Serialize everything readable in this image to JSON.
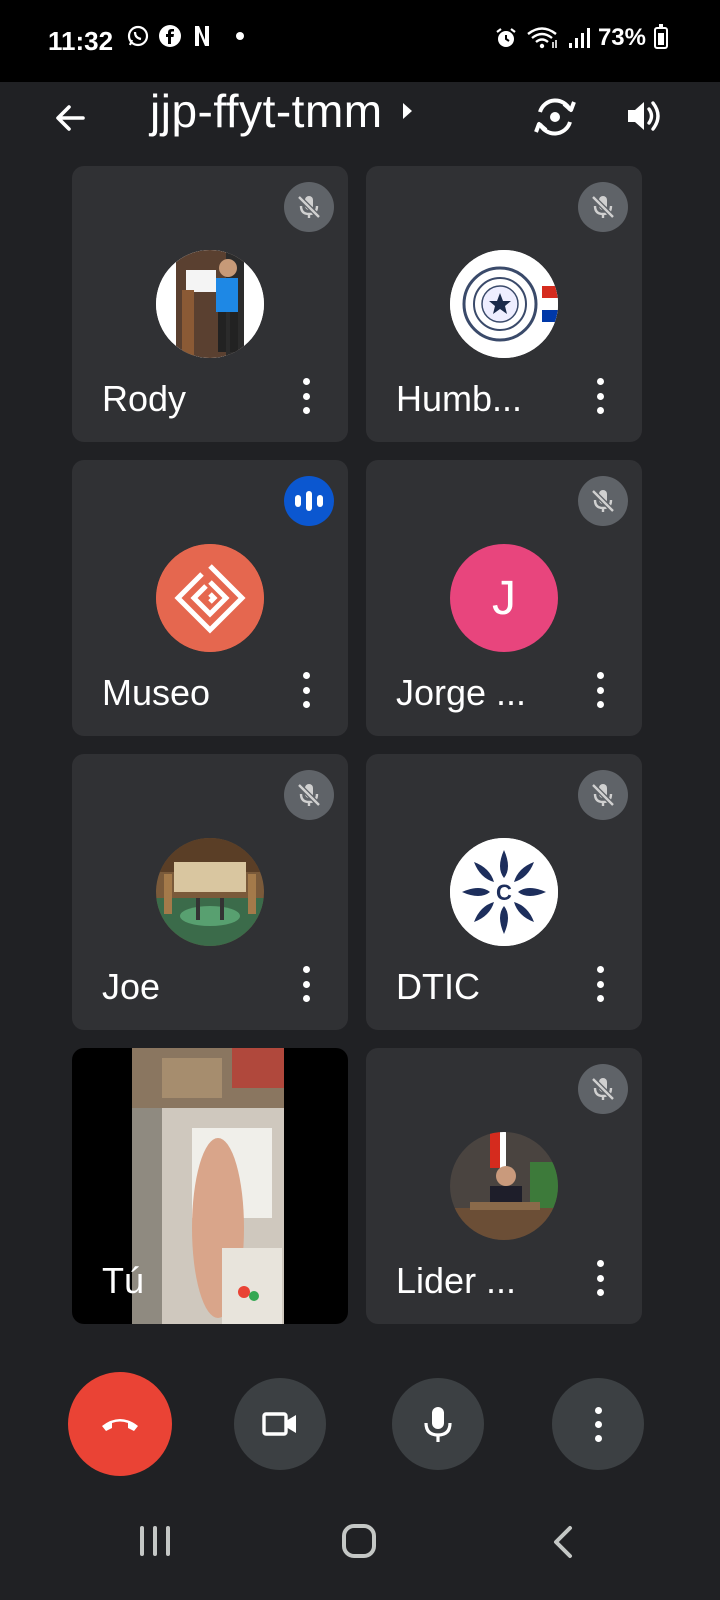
{
  "status_bar": {
    "time": "11:32",
    "battery": "73%"
  },
  "app_bar": {
    "meeting_code": "jjp-ffyt-tmm"
  },
  "participants": [
    {
      "name": "Rody",
      "muted": true,
      "avatar": "photo-person-sign"
    },
    {
      "name": "Humb...",
      "muted": true,
      "avatar": "paraguay-seal"
    },
    {
      "name": "Museo",
      "muted": false,
      "speaking": true,
      "avatar": "museo-logo"
    },
    {
      "name": "Jorge ...",
      "muted": true,
      "avatar": "letter",
      "initial": "J",
      "avatar_color": "#e8457d"
    },
    {
      "name": "Joe",
      "muted": true,
      "avatar": "photo-hall"
    },
    {
      "name": "DTIC",
      "muted": true,
      "avatar": "dtic-logo"
    },
    {
      "name": "Tú",
      "self": true,
      "avatar": "camera-feed"
    },
    {
      "name": "Lider ...",
      "muted": true,
      "avatar": "photo-office"
    }
  ],
  "colors": {
    "background": "#202124",
    "tile": "#303134",
    "end_call": "#ea4335",
    "speaking_accent": "#0b57d0",
    "control": "#3c4043"
  },
  "icons": {
    "back": "arrow-left-icon",
    "switch_camera": "switch-camera-icon",
    "speaker": "speaker-icon",
    "mute": "mic-off-icon",
    "end_call": "phone-hangup-icon",
    "camera": "video-camera-icon",
    "mic": "mic-icon",
    "more": "more-vert-icon"
  }
}
